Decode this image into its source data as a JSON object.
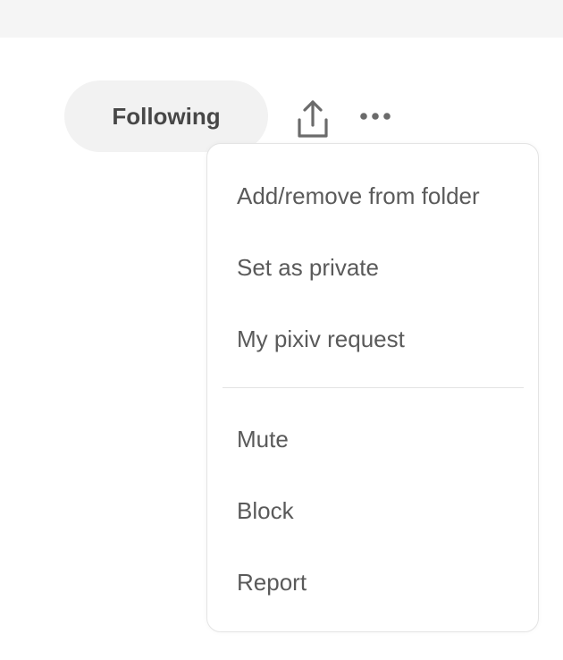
{
  "header": {
    "following_label": "Following"
  },
  "icons": {
    "share": "share-icon",
    "more": "more-options-icon"
  },
  "menu": {
    "group1": [
      {
        "label": "Add/remove from folder"
      },
      {
        "label": "Set as private"
      },
      {
        "label": "My pixiv request"
      }
    ],
    "group2": [
      {
        "label": "Mute"
      },
      {
        "label": "Block"
      },
      {
        "label": "Report"
      }
    ]
  },
  "colors": {
    "text_primary": "#474747",
    "text_menu": "#5a5a5a",
    "button_bg": "#f2f2f2",
    "border": "#e4e4e4",
    "icon": "#6b6b6b"
  }
}
